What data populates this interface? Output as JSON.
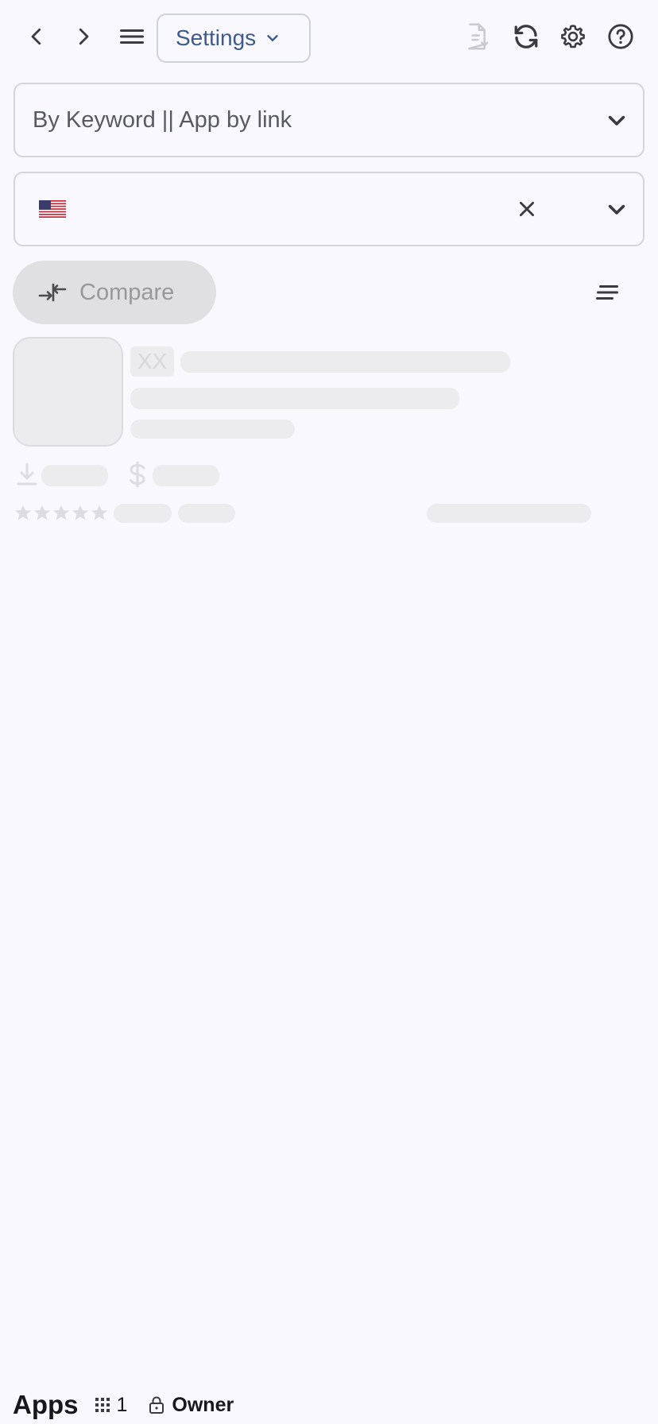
{
  "toolbar": {
    "settings_label": "Settings"
  },
  "search": {
    "placeholder": "By Keyword || App by link"
  },
  "country": {
    "selected_flag": "us-flag-icon"
  },
  "compare": {
    "label": "Compare"
  },
  "skeleton": {
    "badge_text": "XX"
  },
  "footer": {
    "apps_label": "Apps",
    "apps_count": "1",
    "role_label": "Owner"
  },
  "colors": {
    "accent_text": "#3d5a8a",
    "background": "#f8f8fe",
    "skeleton": "#ececef",
    "compare_bg": "#e0e0e3"
  }
}
